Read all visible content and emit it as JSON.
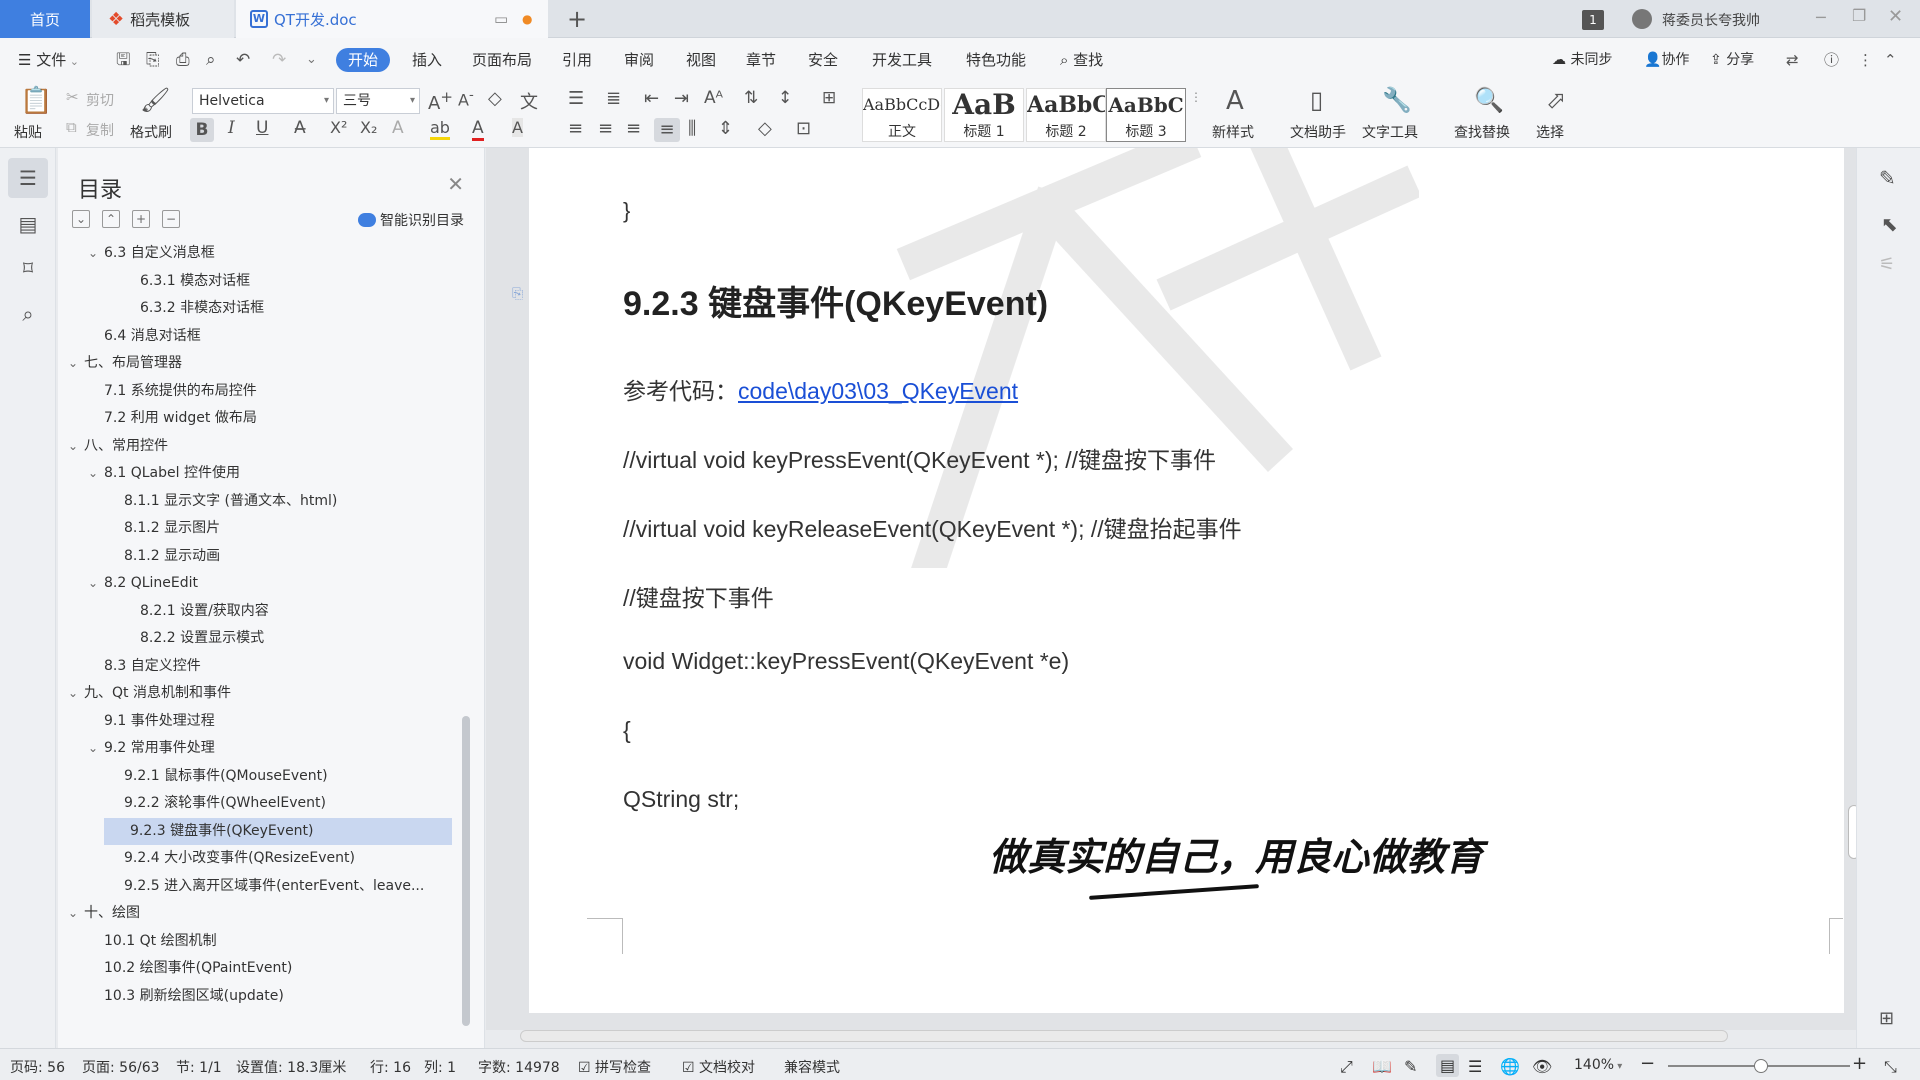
{
  "tabs": {
    "home": "首页",
    "daoke": "稻壳模板",
    "doc": "QT开发.doc",
    "add": "+"
  },
  "titlebar": {
    "page_badge": "1",
    "user": "蒋委员长夸我帅"
  },
  "menu": {
    "file": "文件",
    "items": [
      "开始",
      "插入",
      "页面布局",
      "引用",
      "审阅",
      "视图",
      "章节",
      "安全",
      "开发工具",
      "特色功能"
    ],
    "search": "查找",
    "right": {
      "sync": "未同步",
      "collab": "协作",
      "share": "分享"
    }
  },
  "ribbon": {
    "paste": "粘贴",
    "cut": "剪切",
    "copy": "复制",
    "format_painter": "格式刷",
    "font_name": "Helvetica",
    "font_size": "三号",
    "styles": [
      {
        "sample": "AaBbCcDd",
        "name": "正文"
      },
      {
        "sample": "AaB",
        "name": "标题 1"
      },
      {
        "sample": "AaBbC",
        "name": "标题 2"
      },
      {
        "sample": "AaBbC",
        "name": "标题 3"
      }
    ],
    "new_style": "新样式",
    "doc_helper": "文档助手",
    "text_tools": "文字工具",
    "find_replace": "查找替换",
    "select": "选择"
  },
  "toc": {
    "title": "目录",
    "smart": "智能识别目录",
    "rows": [
      {
        "indent": 2,
        "chev": "⌄",
        "text": "6.3  自定义消息框"
      },
      {
        "indent": 4,
        "chev": "",
        "text": "6.3.1 模态对话框"
      },
      {
        "indent": 4,
        "chev": "",
        "text": "6.3.2 非模态对话框"
      },
      {
        "indent": 2,
        "chev": "",
        "text": "6.4  消息对话框"
      },
      {
        "indent": 1,
        "chev": "⌄",
        "text": "七、布局管理器"
      },
      {
        "indent": 2,
        "chev": "",
        "text": "7.1  系统提供的布局控件"
      },
      {
        "indent": 2,
        "chev": "",
        "text": "7.2  利用 widget 做布局"
      },
      {
        "indent": 1,
        "chev": "⌄",
        "text": "八、常用控件"
      },
      {
        "indent": 2,
        "chev": "⌄",
        "text": "8.1 QLabel 控件使用"
      },
      {
        "indent": 3,
        "chev": "",
        "text": "8.1.1 显示文字    (普通文本、html)"
      },
      {
        "indent": 3,
        "chev": "",
        "text": "8.1.2 显示图片"
      },
      {
        "indent": 3,
        "chev": "",
        "text": "8.1.2 显示动画"
      },
      {
        "indent": 2,
        "chev": "⌄",
        "text": "8.2 QLineEdit"
      },
      {
        "indent": 4,
        "chev": "",
        "text": "8.2.1 设置/获取内容"
      },
      {
        "indent": 4,
        "chev": "",
        "text": "8.2.2 设置显示模式"
      },
      {
        "indent": 2,
        "chev": "",
        "text": "8.3  自定义控件"
      },
      {
        "indent": 1,
        "chev": "⌄",
        "text": "九、Qt 消息机制和事件"
      },
      {
        "indent": 2,
        "chev": "",
        "text": "9.1  事件处理过程"
      },
      {
        "indent": 2,
        "chev": "⌄",
        "text": "9.2  常用事件处理"
      },
      {
        "indent": 3,
        "chev": "",
        "text": "9.2.1  鼠标事件(QMouseEvent)"
      },
      {
        "indent": 3,
        "chev": "",
        "text": "9.2.2  滚轮事件(QWheelEvent)"
      },
      {
        "indent": 3,
        "chev": "",
        "text": "9.2.3  键盘事件(QKeyEvent)",
        "selected": true
      },
      {
        "indent": 3,
        "chev": "",
        "text": "9.2.4  大小改变事件(QResizeEvent)"
      },
      {
        "indent": 3,
        "chev": "",
        "text": "9.2.5  进入离开区域事件(enterEvent、leave..."
      },
      {
        "indent": 1,
        "chev": "⌄",
        "text": "十、绘图"
      },
      {
        "indent": 2,
        "chev": "",
        "text": "10.1  Qt 绘图机制"
      },
      {
        "indent": 2,
        "chev": "",
        "text": "10.2  绘图事件(QPaintEvent)"
      },
      {
        "indent": 2,
        "chev": "",
        "text": "10.3  刷新绘图区域(update)"
      }
    ]
  },
  "doc": {
    "brace_close": "}",
    "heading": "9.2.3  键盘事件(QKeyEvent)",
    "ref_label": "参考代码：",
    "ref_link": "code\\day03\\03_QKeyEvent",
    "line1": "//virtual void keyPressEvent(QKeyEvent *); //键盘按下事件",
    "line2": "//virtual void keyReleaseEvent(QKeyEvent *); //键盘抬起事件",
    "line3": "//键盘按下事件",
    "line4": "void Widget::keyPressEvent(QKeyEvent *e)",
    "line5": "{",
    "line6": "QString str;",
    "slogan": "做真实的自己，用良心做教育"
  },
  "status": {
    "page_no": "页码: 56",
    "page": "页面: 56/63",
    "section": "节: 1/1",
    "setting": "设置值: 18.3厘米",
    "row": "行: 16",
    "col": "列: 1",
    "words": "字数: 14978",
    "spell": "拼写检查",
    "proof": "文档校对",
    "compat": "兼容模式",
    "zoom": "140%"
  }
}
